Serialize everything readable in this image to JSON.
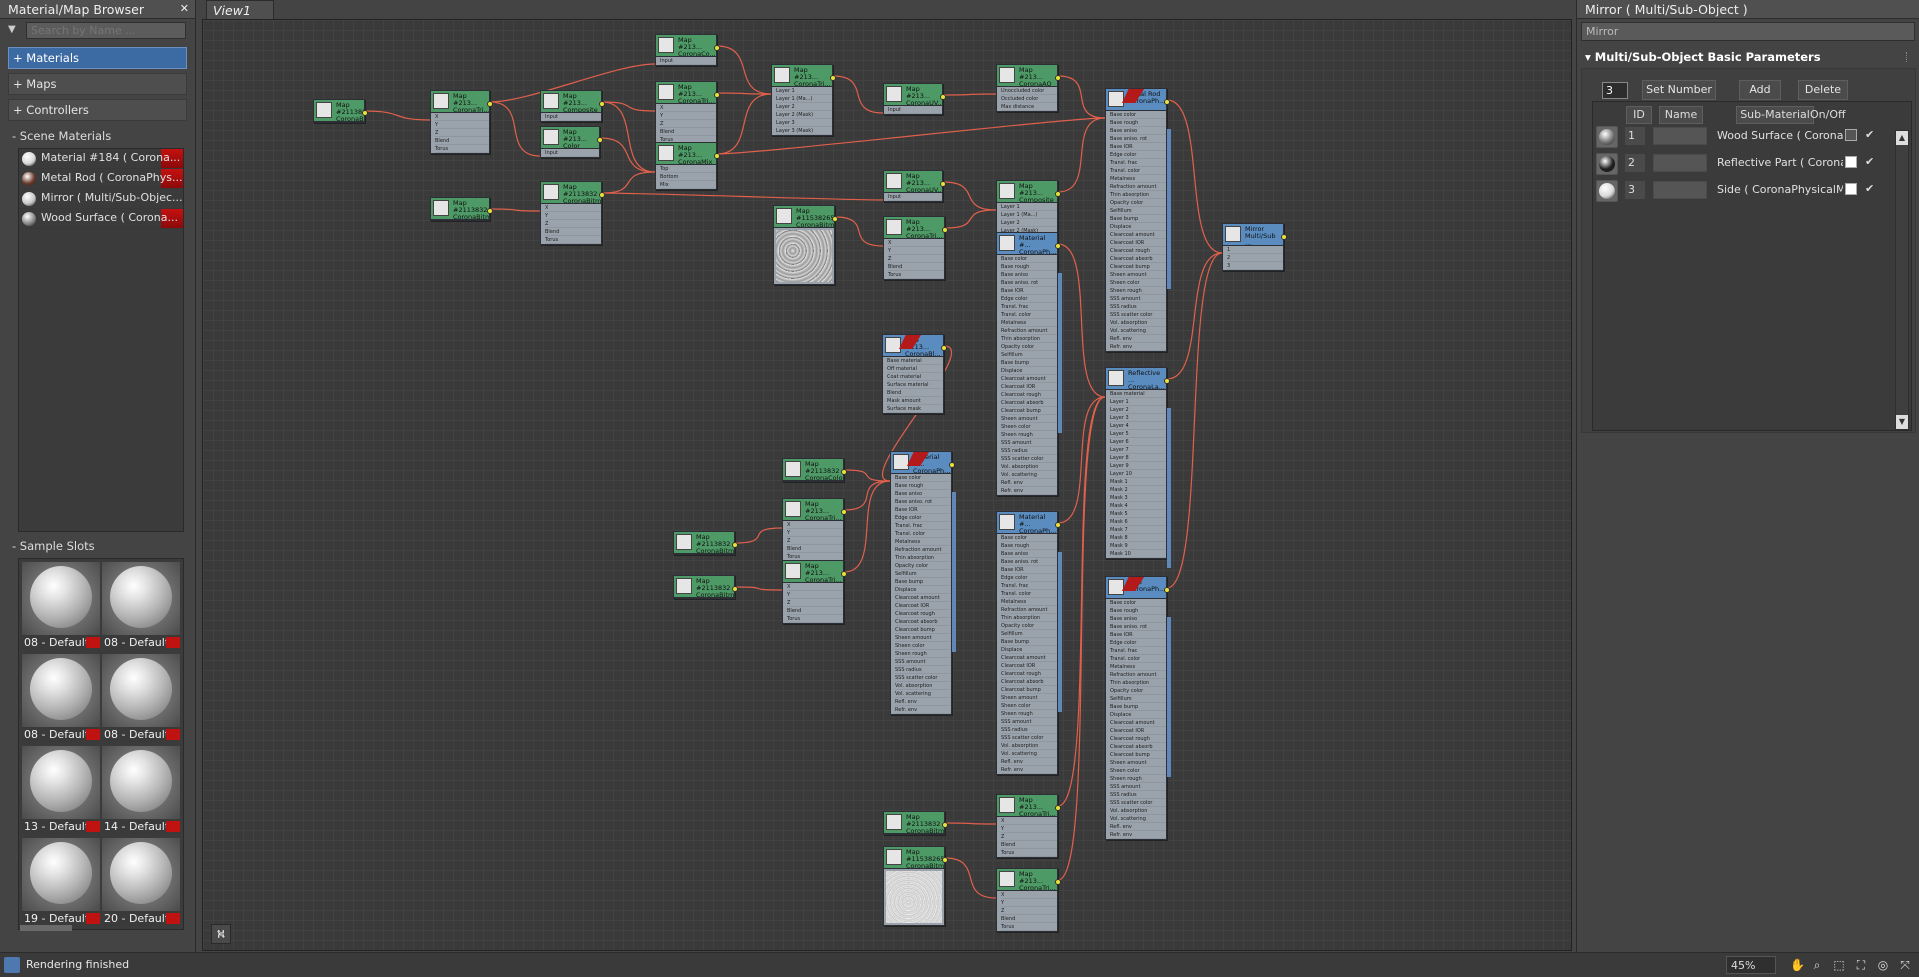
{
  "browser": {
    "title": "Material/Map Browser",
    "search_placeholder": "Search by Name ...",
    "sections": [
      "+ Materials",
      "+ Maps",
      "+ Controllers"
    ],
    "scene_group": "- Scene Materials",
    "scene_items": [
      {
        "label": "Material #184  ( Corona...",
        "color": "#d8d8d8"
      },
      {
        "label": "Metal Rod  ( CoronaPhys...",
        "color": "#6a3a2a"
      },
      {
        "label": "Mirror  ( Multi/Sub-Objec...",
        "color": "#c8c8c8"
      },
      {
        "label": "Wood Surface  ( Corona...",
        "color": "#8a8a8a"
      }
    ],
    "slots_group": "- Sample Slots",
    "slots": [
      "08 - Default...",
      "08 - Default...",
      "08 - Default...",
      "08 - Default...",
      "13 - Default...",
      "14 - Default...",
      "19 - Default...",
      "20 - Default..."
    ]
  },
  "view": {
    "tab": "View1",
    "nodes": {
      "n01": {
        "t1": "Map #2113832",
        "t2": "CoronaBitmap"
      },
      "n02": {
        "t1": "Map #213...",
        "t2": "CoronaTri..."
      },
      "n03": {
        "t1": "Map #213...",
        "t2": "CoronaCo..."
      },
      "n04": {
        "t1": "Map #213...",
        "t2": "CoronaTri..."
      },
      "n05": {
        "t1": "Map #213...",
        "t2": "CoronaMix"
      },
      "n06": {
        "t1": "Map #2113832",
        "t2": "CoronaBitmap"
      },
      "n07": {
        "t1": "Map #213...",
        "t2": "Color Cor..."
      },
      "n08": {
        "t1": "Map #213...",
        "t2": "Composite"
      },
      "n09": {
        "t1": "Map #2113832",
        "t2": "CoronaBitmap"
      },
      "n10": {
        "t1": "Map #213...",
        "t2": "CoronaTri..."
      },
      "n11": {
        "t1": "Map #213...",
        "t2": "CoronaUV..."
      },
      "n12": {
        "t1": "Map #213...",
        "t2": "CoronaAO"
      },
      "n13": {
        "t1": "Map #213...",
        "t2": "CoronaUV..."
      },
      "n14": {
        "t1": "Map #213...",
        "t2": "Composite"
      },
      "n15": {
        "t1": "Map #1153826590",
        "t2": "CoronaBitmap"
      },
      "n16": {
        "t1": "Map #213...",
        "t2": "CoronaTri..."
      },
      "n17": {
        "t1": "Material #...",
        "t2": "CoronaPh..."
      },
      "n18": {
        "t1": "Metal Rod",
        "t2": "CoronaPh..."
      },
      "n19": {
        "t1": "Mirror",
        "t2": "Multi/Sub ..."
      },
      "n20": {
        "t1": "Material #...",
        "t2": "CoronaPh..."
      },
      "n21": {
        "t1": "Map #213...",
        "t2": "CoronaBl..."
      },
      "n22": {
        "t1": "Reflective ...",
        "t2": "CoronaLa..."
      },
      "n23": {
        "t1": "Map #2113832",
        "t2": "CoronaColor"
      },
      "n24": {
        "t1": "Material #...",
        "t2": "CoronaPh..."
      },
      "n25": {
        "t1": "Map #213...",
        "t2": "CoronaTri..."
      },
      "n26": {
        "t1": "Map #2113832",
        "t2": "CoronaBitmap"
      },
      "n27": {
        "t1": "Map #213...",
        "t2": "CoronaTri..."
      },
      "n28": {
        "t1": "Map #2113832",
        "t2": "CoronaBitmap"
      },
      "n29": {
        "t1": "Material #...",
        "t2": "CoronaPh..."
      },
      "n30": {
        "t1": "Side",
        "t2": "CoronaPh..."
      },
      "n31": {
        "t1": "Map #2113832",
        "t2": "CoronaBitmap"
      },
      "n32": {
        "t1": "Map #213...",
        "t2": "CoronaTri..."
      },
      "n33": {
        "t1": "Map #1153826590",
        "t2": "CoronaBitmap"
      },
      "n34": {
        "t1": "Map #213...",
        "t2": "CoronaTri..."
      }
    }
  },
  "rows": {
    "tri": [
      "X",
      "Y",
      "Z",
      "Blend",
      "Torus"
    ],
    "mix": [
      "Top",
      "Bottom",
      "Mix"
    ],
    "comp": [
      "Layer 1",
      "Layer 1 (Ma...)",
      "Layer 2",
      "Layer 2 (Mask)",
      "Layer 3",
      "Layer 3 (Mask)"
    ],
    "ao": [
      "Unoccluded color",
      "Occluded color",
      "Max distance"
    ],
    "uv": [
      "Input"
    ],
    "blend": [
      "Base material",
      "Off material",
      "Coat material",
      "Surface material",
      "Blend",
      "Mask amount",
      "Surface mask"
    ],
    "cc": [
      "Input"
    ],
    "mtl": [
      "Base color",
      "Base rough",
      "Base aniso",
      "Base aniso. rot",
      "Base IOR",
      "Edge color",
      "Transl. frac",
      "Transl. color",
      "Metalness",
      "Refraction amount",
      "Thin absorption",
      "Opacity color",
      "Selfillum",
      "Base bump",
      "Displace",
      "Clearcoat amount",
      "Clearcoat IOR",
      "Clearcoat rough",
      "Clearcoat absorb",
      "Clearcoat bump",
      "Sheen amount",
      "Sheen color",
      "Sheen rough",
      "SSS amount",
      "SSS radius",
      "SSS scatter color",
      "Vol. absorption",
      "Vol. scattering",
      "Refl. env",
      "Refr. env"
    ],
    "layered": [
      "Base material",
      "Layer 1",
      "Layer 2",
      "Layer 3",
      "Layer 4",
      "Layer 5",
      "Layer 6",
      "Layer 7",
      "Layer 8",
      "Layer 9",
      "Layer 10",
      "Mask 1",
      "Mask 2",
      "Mask 3",
      "Mask 4",
      "Mask 5",
      "Mask 6",
      "Mask 7",
      "Mask 8",
      "Mask 9",
      "Mask 10"
    ],
    "multi": [
      "1",
      "2",
      "3"
    ]
  },
  "editor": {
    "title": "Mirror  ( Multi/Sub-Object )",
    "name_value": "Mirror",
    "rollout": "Multi/Sub-Object Basic Parameters",
    "count": "3",
    "set_number": "Set Number",
    "add": "Add",
    "delete": "Delete",
    "col_id": "ID",
    "col_name": "Name",
    "col_sub": "Sub-Material",
    "col_onoff": "On/Off",
    "rows": [
      {
        "id": "1",
        "material": "Wood Surface  ( CoronaPh",
        "ball": "#777777",
        "swatch": "#555555"
      },
      {
        "id": "2",
        "material": "Reflective Part  ( CoronaLa",
        "ball": "#1e1e1e",
        "swatch": "#ffffff"
      },
      {
        "id": "3",
        "material": "Side  ( CoronaPhysicalMtl",
        "ball": "#d9d9d9",
        "swatch": "#ffffff"
      }
    ]
  },
  "status": {
    "text": "Rendering finished",
    "zoom": "45%"
  },
  "colors": {
    "map_header": "#4e9a66",
    "material_header": "#5a8cbf",
    "wire": "#e0604c",
    "selection": "#3c6aa3"
  }
}
